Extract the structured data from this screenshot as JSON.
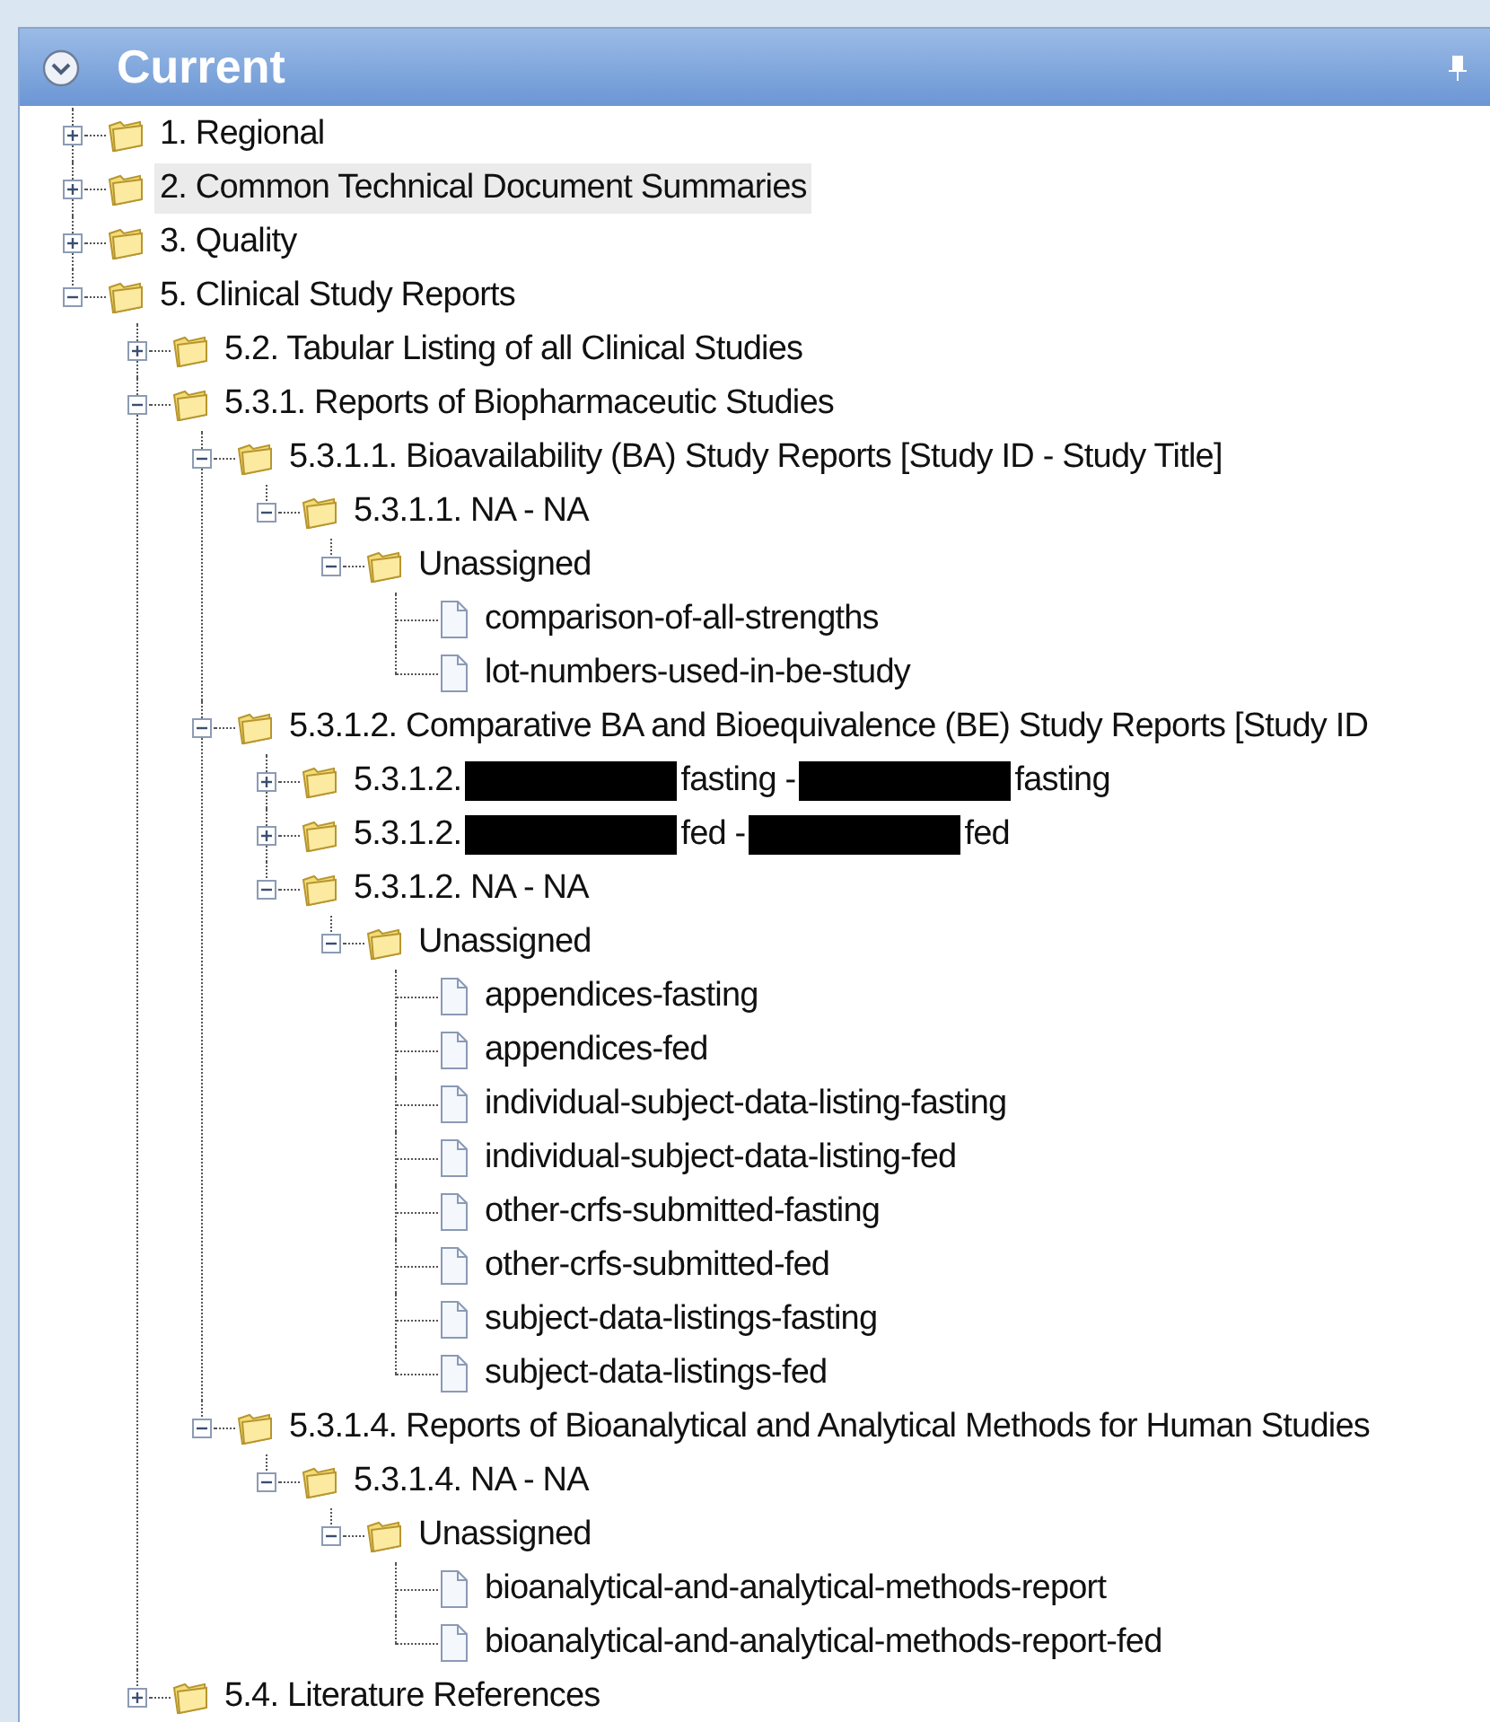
{
  "panel": {
    "title": "Current"
  },
  "tree": [
    {
      "kind": "folder",
      "label": "1. Regional",
      "expanded": false,
      "selected": false
    },
    {
      "kind": "folder",
      "label": "2. Common Technical Document Summaries",
      "expanded": false,
      "selected": true
    },
    {
      "kind": "folder",
      "label": "3. Quality",
      "expanded": false,
      "selected": false
    },
    {
      "kind": "folder",
      "label": "5. Clinical Study Reports",
      "expanded": true,
      "selected": false,
      "children": [
        {
          "kind": "folder",
          "label": "5.2. Tabular Listing of all Clinical Studies",
          "expanded": false,
          "selected": false
        },
        {
          "kind": "folder",
          "label": "5.3.1. Reports of Biopharmaceutic Studies",
          "expanded": true,
          "selected": false,
          "children": [
            {
              "kind": "folder",
              "label": "5.3.1.1. Bioavailability (BA) Study Reports [Study ID - Study Title]",
              "expanded": true,
              "selected": false,
              "children": [
                {
                  "kind": "folder",
                  "label": "5.3.1.1. NA - NA",
                  "expanded": true,
                  "selected": false,
                  "children": [
                    {
                      "kind": "folder",
                      "label": "Unassigned",
                      "expanded": true,
                      "selected": false,
                      "children": [
                        {
                          "kind": "file",
                          "label": "comparison-of-all-strengths",
                          "selected": false
                        },
                        {
                          "kind": "file",
                          "label": "lot-numbers-used-in-be-study",
                          "selected": false
                        }
                      ]
                    }
                  ]
                }
              ]
            },
            {
              "kind": "folder",
              "label": "5.3.1.2. Comparative BA and Bioequivalence (BE) Study Reports [Study ID",
              "expanded": true,
              "selected": false,
              "children": [
                {
                  "kind": "folder",
                  "segments": [
                    {
                      "kind": "text",
                      "text": "5.3.1.2."
                    },
                    {
                      "kind": "redacted"
                    },
                    {
                      "kind": "text",
                      "text": "fasting -"
                    },
                    {
                      "kind": "redacted"
                    },
                    {
                      "kind": "text",
                      "text": "fasting"
                    }
                  ],
                  "expanded": false,
                  "selected": false
                },
                {
                  "kind": "folder",
                  "segments": [
                    {
                      "kind": "text",
                      "text": "5.3.1.2."
                    },
                    {
                      "kind": "redacted"
                    },
                    {
                      "kind": "text",
                      "text": "fed -"
                    },
                    {
                      "kind": "redacted"
                    },
                    {
                      "kind": "text",
                      "text": "fed"
                    }
                  ],
                  "expanded": false,
                  "selected": false
                },
                {
                  "kind": "folder",
                  "label": "5.3.1.2. NA - NA",
                  "expanded": true,
                  "selected": false,
                  "children": [
                    {
                      "kind": "folder",
                      "label": "Unassigned",
                      "expanded": true,
                      "selected": false,
                      "children": [
                        {
                          "kind": "file",
                          "label": "appendices-fasting",
                          "selected": false
                        },
                        {
                          "kind": "file",
                          "label": "appendices-fed",
                          "selected": false
                        },
                        {
                          "kind": "file",
                          "label": "individual-subject-data-listing-fasting",
                          "selected": false
                        },
                        {
                          "kind": "file",
                          "label": "individual-subject-data-listing-fed",
                          "selected": false
                        },
                        {
                          "kind": "file",
                          "label": "other-crfs-submitted-fasting",
                          "selected": false
                        },
                        {
                          "kind": "file",
                          "label": "other-crfs-submitted-fed",
                          "selected": false
                        },
                        {
                          "kind": "file",
                          "label": "subject-data-listings-fasting",
                          "selected": false
                        },
                        {
                          "kind": "file",
                          "label": "subject-data-listings-fed",
                          "selected": false
                        }
                      ]
                    }
                  ]
                }
              ]
            },
            {
              "kind": "folder",
              "label": "5.3.1.4. Reports of Bioanalytical and Analytical Methods for Human Studies",
              "expanded": true,
              "selected": false,
              "children": [
                {
                  "kind": "folder",
                  "label": "5.3.1.4. NA - NA",
                  "expanded": true,
                  "selected": false,
                  "children": [
                    {
                      "kind": "folder",
                      "label": "Unassigned",
                      "expanded": true,
                      "selected": false,
                      "children": [
                        {
                          "kind": "file",
                          "label": "bioanalytical-and-analytical-methods-report",
                          "selected": false
                        },
                        {
                          "kind": "file",
                          "label": "bioanalytical-and-analytical-methods-report-fed",
                          "selected": false
                        }
                      ]
                    }
                  ]
                }
              ]
            }
          ]
        },
        {
          "kind": "folder",
          "label": "5.4. Literature References",
          "expanded": false,
          "selected": false
        }
      ]
    }
  ]
}
